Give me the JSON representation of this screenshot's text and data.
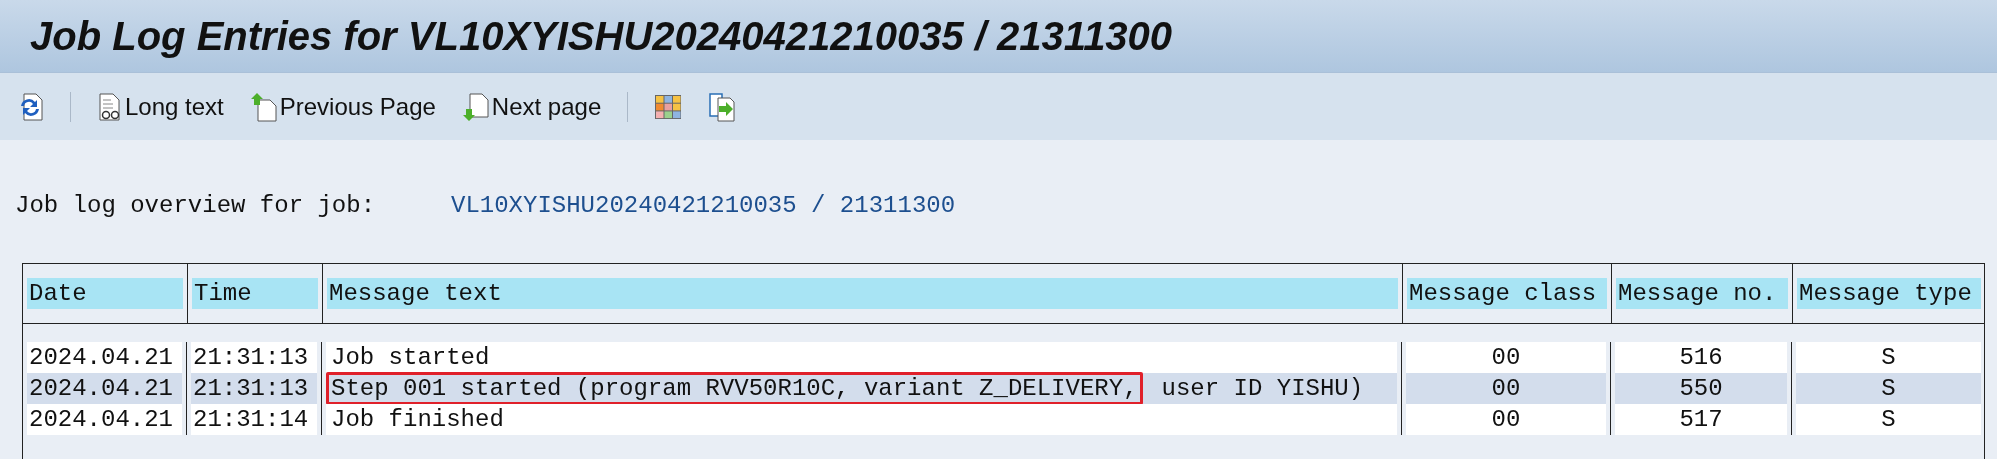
{
  "window": {
    "title": "Job Log Entries for VL10XYISHU20240421210035 / 21311300"
  },
  "toolbar": [
    {
      "kind": "refresh"
    },
    {
      "kind": "longtext",
      "label": "Long text"
    },
    {
      "kind": "prev",
      "label": "Previous Page"
    },
    {
      "kind": "next",
      "label": "Next page"
    },
    {
      "kind": "layout"
    },
    {
      "kind": "export"
    }
  ],
  "overview": {
    "label": "Job log overview for job:",
    "value": "VL10XYISHU20240421210035 / 21311300"
  },
  "table": {
    "columns": [
      "Date",
      "Time",
      "Message text",
      "Message class",
      "Message no.",
      "Message type"
    ],
    "rows": [
      {
        "selected": false,
        "date": "2024.04.21",
        "time": "21:31:13",
        "message": [
          {
            "text": "Job started",
            "boxed": false
          }
        ],
        "message_class": "00",
        "message_no": "516",
        "message_type": "S"
      },
      {
        "selected": true,
        "date": "2024.04.21",
        "time": "21:31:13",
        "message": [
          {
            "text": "Step 001 started (program RVV50R10C, variant Z_DELIVERY,",
            "boxed": true
          },
          {
            "text": "user ID YISHU)",
            "boxed": false
          }
        ],
        "message_class": "00",
        "message_no": "550",
        "message_type": "S"
      },
      {
        "selected": false,
        "date": "2024.04.21",
        "time": "21:31:14",
        "message": [
          {
            "text": "Job finished",
            "boxed": false
          }
        ],
        "message_class": "00",
        "message_no": "517",
        "message_type": "S"
      }
    ]
  }
}
